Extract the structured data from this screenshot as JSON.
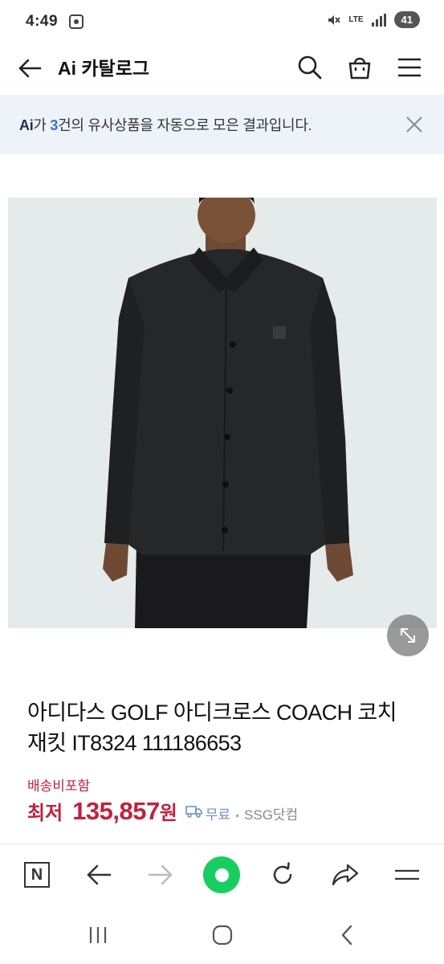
{
  "status_bar": {
    "time": "4:49",
    "network": "LTE",
    "battery": "41"
  },
  "header": {
    "title": "Ai 카탈로그"
  },
  "ai_banner": {
    "logo": "Ai",
    "text_before": "가 ",
    "count": "3",
    "text_after": "건의 유사상품을 자동으로 모은 결과입니다."
  },
  "product": {
    "image_desc": "black-coach-jacket-photo",
    "name": "아디다스 GOLF 아디크로스 COACH 코치 재킷 IT8324 111186653",
    "shipping_label": "배송비포함",
    "price_prefix": "최저",
    "price_value": "135,857",
    "price_unit": "원",
    "shipping_free": "무료",
    "store": "SSG닷컴"
  },
  "colors": {
    "price_red": "#c0223e",
    "naver_green": "#19ce60",
    "banner_bg": "#eef3f9",
    "count_blue": "#3a6fd8"
  },
  "icons": {
    "back": "arrow-left-icon",
    "search": "search-icon",
    "bag": "shopping-bag-icon",
    "menu": "hamburger-menu-icon",
    "close": "close-icon",
    "zoom": "expand-icon"
  }
}
